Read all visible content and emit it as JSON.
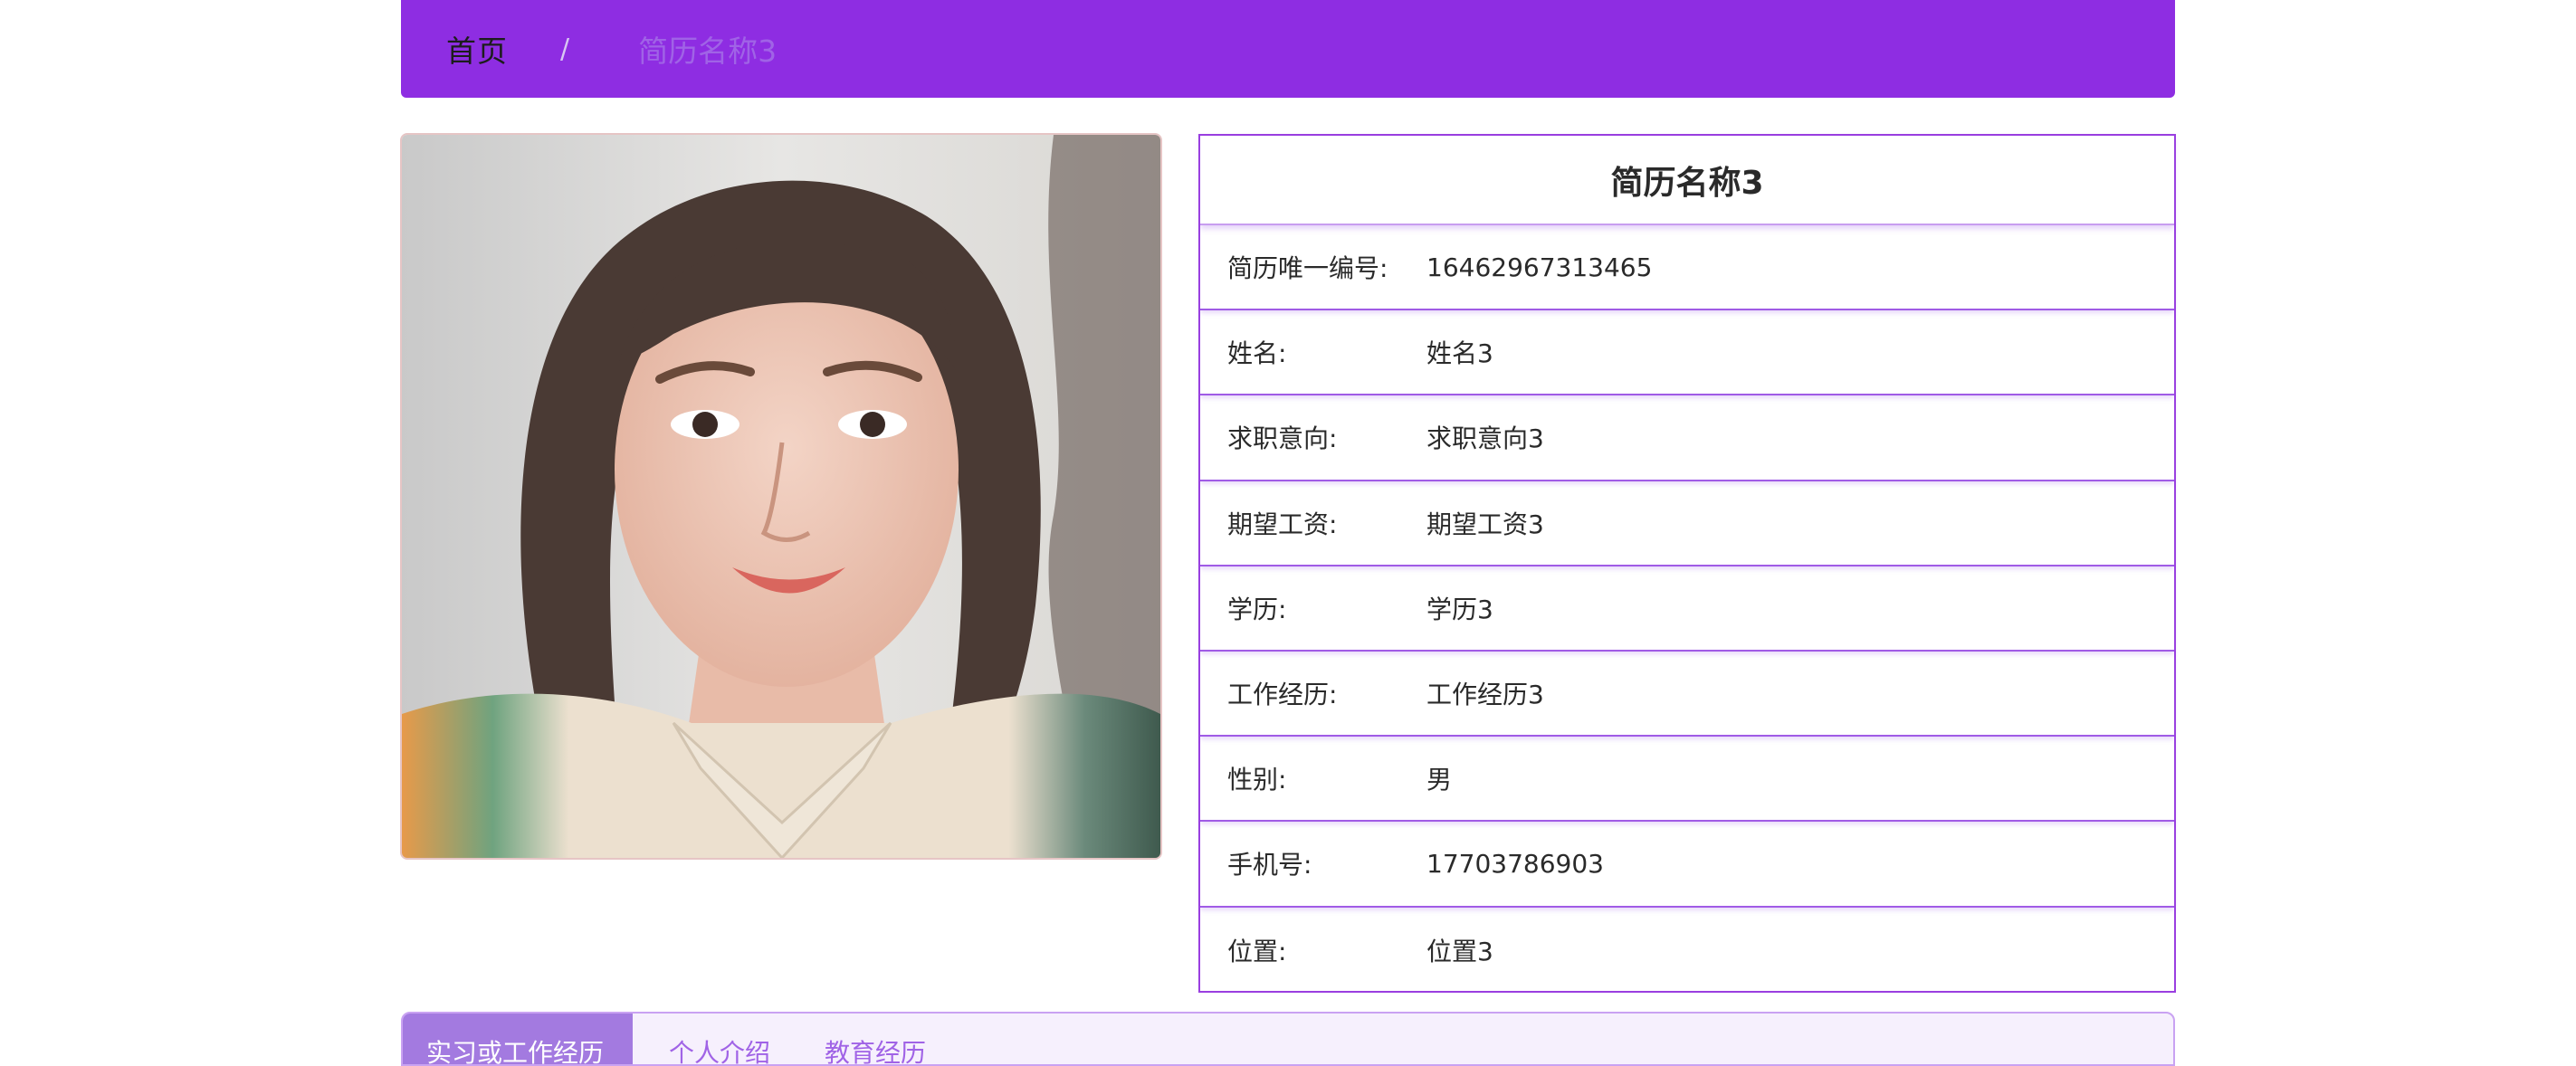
{
  "breadcrumb": {
    "home": "首页",
    "separator": "/",
    "current": "简历名称3"
  },
  "photo": {
    "alt": "profile-photo"
  },
  "resume": {
    "title": "简历名称3",
    "fields": [
      {
        "label": "简历唯一编号:",
        "value": "16462967313465"
      },
      {
        "label": "姓名:",
        "value": "姓名3"
      },
      {
        "label": "求职意向:",
        "value": "求职意向3"
      },
      {
        "label": "期望工资:",
        "value": "期望工资3"
      },
      {
        "label": "学历:",
        "value": "学历3"
      },
      {
        "label": "工作经历:",
        "value": "工作经历3"
      },
      {
        "label": "性别:",
        "value": "男"
      },
      {
        "label": "手机号:",
        "value": "17703786903"
      },
      {
        "label": "位置:",
        "value": "位置3"
      }
    ]
  },
  "tabs": [
    {
      "label": "实习或工作经历",
      "active": true
    },
    {
      "label": "个人介绍",
      "active": false
    },
    {
      "label": "教育经历",
      "active": false
    }
  ],
  "colors": {
    "accent": "#8e2de2",
    "border": "#9a3fe0",
    "tab_active": "#a37ae0",
    "tab_text": "#a063e6"
  }
}
